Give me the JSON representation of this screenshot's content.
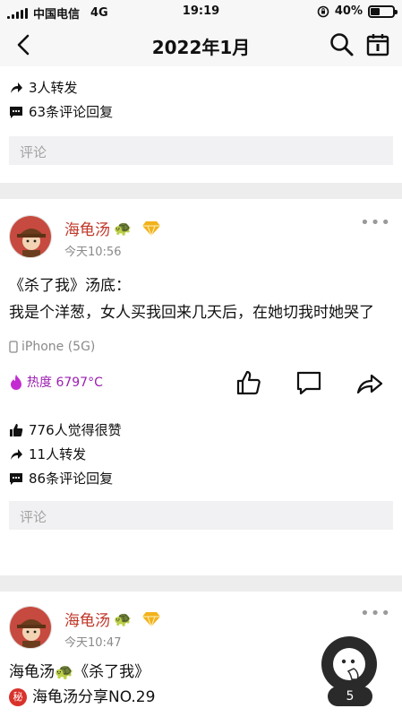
{
  "status_bar": {
    "carrier": "中国电信",
    "network": "4G",
    "time": "19:19",
    "battery": "40%",
    "battery_level": 0.4
  },
  "nav": {
    "title": "2022年1月"
  },
  "prev_post": {
    "shares": "3人转发",
    "comments": "63条评论回复",
    "comment_placeholder": "评论"
  },
  "post1": {
    "author": "海龟汤",
    "time": "今天10:56",
    "text_line1": "《杀了我》汤底：",
    "text_line2": "我是个洋葱，女人买我回来几天后，在她切我时她哭了",
    "device": "iPhone (5G)",
    "heat": "热度 6797°C",
    "likes": "776人觉得很赞",
    "shares": "11人转发",
    "comments": "86条评论回复",
    "comment_placeholder": "评论"
  },
  "post2": {
    "author": "海龟汤",
    "time": "今天10:47",
    "text_line1": "海龟汤🐢《杀了我》",
    "text_line2": "海龟汤分享NO.29"
  },
  "fab": {
    "count": "5"
  },
  "colors": {
    "author": "#c0392b",
    "heat": "#9b1fb0",
    "background": "#ededed"
  }
}
